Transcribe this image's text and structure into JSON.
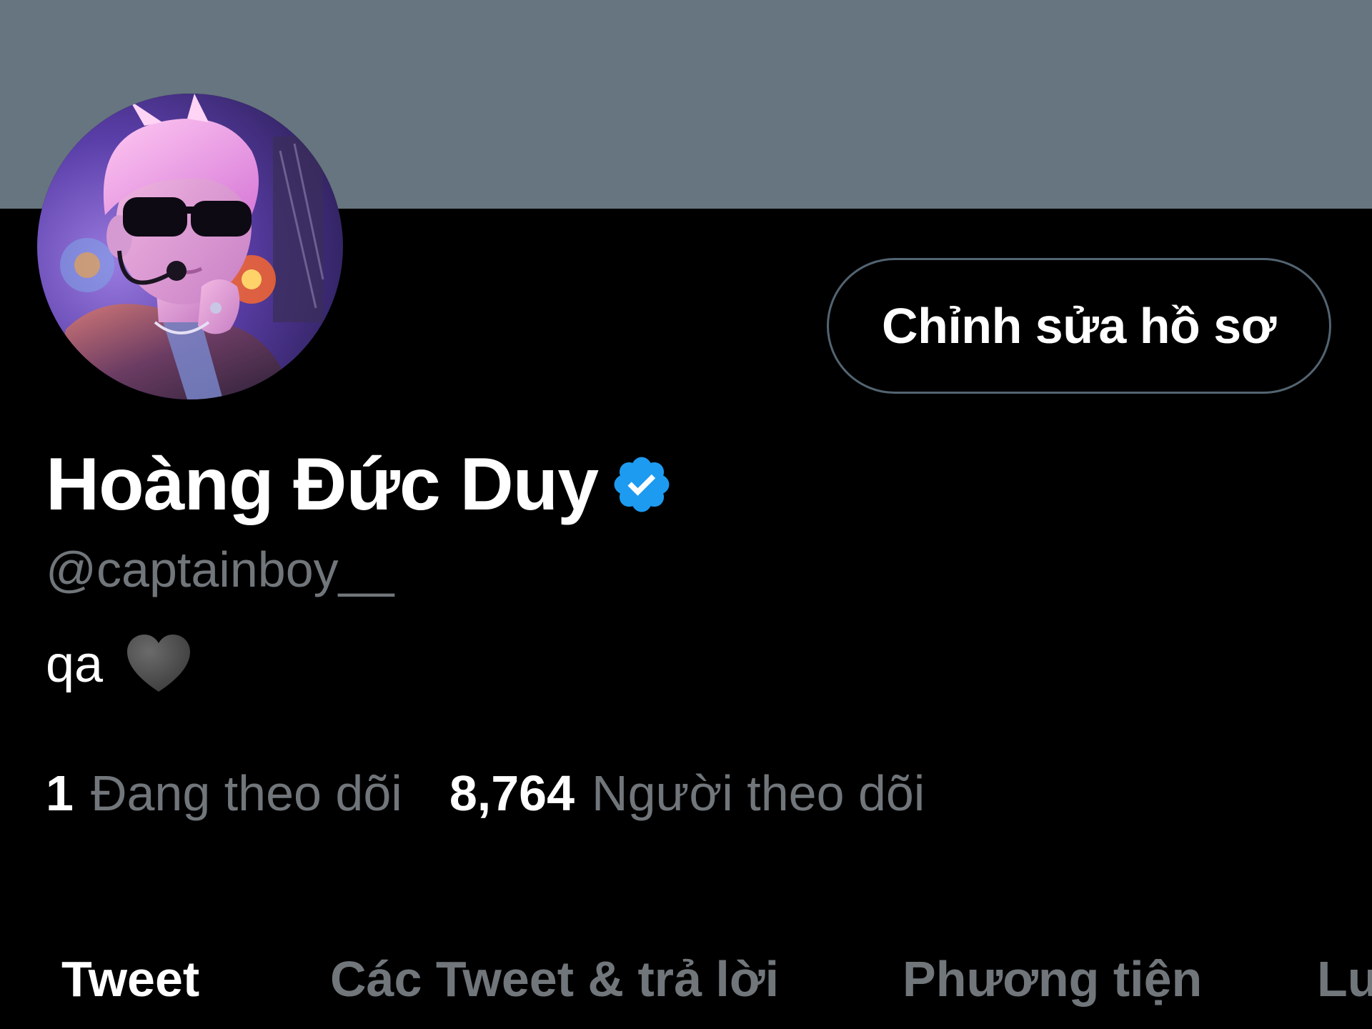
{
  "profile": {
    "edit_button_label": "Chỉnh sửa hồ sơ",
    "display_name": "Hoàng Đức Duy",
    "handle": "@captainboy__",
    "bio_text": "qa",
    "bio_emoji": "black-heart-icon",
    "verified": true
  },
  "stats": {
    "following_count": "1",
    "following_label": "Đang theo dõi",
    "followers_count": "8,764",
    "followers_label": "Người theo dõi"
  },
  "tabs": [
    {
      "label": "Tweet",
      "active": true
    },
    {
      "label": "Các Tweet & trả lời",
      "active": false
    },
    {
      "label": "Phương tiện",
      "active": false
    },
    {
      "label": "Lượt thích",
      "active": false
    }
  ],
  "colors": {
    "background": "#000000",
    "banner": "#66757f",
    "text_primary": "#ffffff",
    "text_secondary": "#71767b",
    "button_border": "#536471",
    "verified_badge": "#1d9bf0"
  }
}
